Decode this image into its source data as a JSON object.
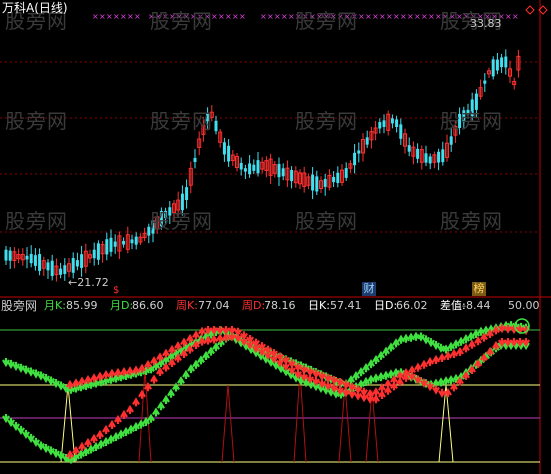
{
  "header": {
    "title": "万科A(日线)"
  },
  "price": {
    "high_label": "33.83",
    "low_label": "←21.72"
  },
  "watermark": "股旁网",
  "badges": {
    "cai": "财",
    "bang": "榜",
    "dollar": "$"
  },
  "indicator": {
    "name": "股旁网",
    "readouts": [
      {
        "key": "月K:",
        "value": "85.99",
        "color": "#40e040"
      },
      {
        "key": "月D:",
        "value": "86.60",
        "color": "#40e040"
      },
      {
        "key": "周K:",
        "value": "77.04",
        "color": "#ff3030"
      },
      {
        "key": "周D:",
        "value": "78.16",
        "color": "#ff3030"
      },
      {
        "key": "日K:",
        "value": "57.41",
        "color": "#ffffff"
      },
      {
        "key": "日D:",
        "value": "66.02",
        "color": "#ffffff"
      },
      {
        "key": "差值:",
        "value": "-8.44",
        "color": "#ffffff"
      }
    ],
    "scale_label": "50.00"
  },
  "colors": {
    "up": "#ff3030",
    "down": "#40e0f0",
    "magenta": "#e040e0",
    "green": "#40e040",
    "yellow": "#ffff80",
    "purple": "#c040c0"
  }
}
